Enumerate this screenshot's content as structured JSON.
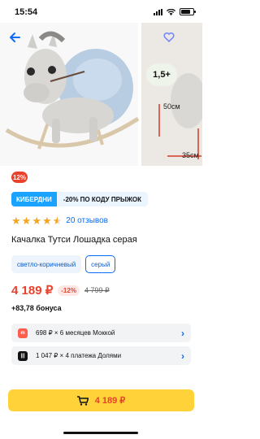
{
  "status_bar": {
    "time": "15:54",
    "battery_level": 0.8
  },
  "gallery": {
    "back_icon": "back-arrow-icon",
    "favorite_icon": "heart-icon",
    "age_badge": "1,5+",
    "height_label": "50см",
    "depth_label": "35см"
  },
  "discount_chip": "12%",
  "promo": {
    "tag": "КИБЕРДНИ",
    "text": "-20% ПО КОДУ ПРЫЖОК"
  },
  "rating": {
    "stars": 4.5,
    "reviews": "20 отзывов"
  },
  "product": {
    "title": "Качалка Тутси Лошадка серая"
  },
  "variants": [
    {
      "label": "светло-коричневый",
      "selected": false
    },
    {
      "label": "серый",
      "selected": true
    }
  ],
  "price": {
    "current": "4 189 ₽",
    "discount": "-12%",
    "old": "4 799 ₽"
  },
  "bonus": "+83,78 бонуса",
  "installments": [
    {
      "label": "698 ₽ × 6 месяцев Моккой",
      "icon": "mokka-icon",
      "color": "#ff5e4f"
    },
    {
      "label": "1 047 ₽ × 4 платежа Долями",
      "icon": "dolyami-icon",
      "color": "#111111"
    }
  ],
  "cart": {
    "price": "4 189 ₽",
    "icon": "cart-icon"
  },
  "colors": {
    "accent": "#0a6cf5",
    "price": "#e8412c",
    "cart_button": "#ffd23a",
    "promo_tag": "#1aa2ff"
  }
}
